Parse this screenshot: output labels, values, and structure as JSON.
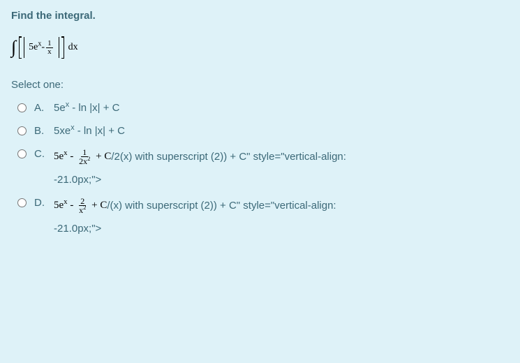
{
  "question": "Find the integral.",
  "integral": {
    "main": "5e",
    "exp": "x",
    "minus": " - ",
    "fnum": "1",
    "fden": "x",
    "dx": "dx"
  },
  "select": "Select one:",
  "options": {
    "a": {
      "label": "A.",
      "pre": "5e",
      "exp": "x",
      "rest": " - ln |x| + C"
    },
    "b": {
      "label": "B.",
      "pre": "5xe",
      "exp": "x",
      "rest": " - ln |x| + C"
    },
    "c": {
      "label": "C.",
      "pre": "5e",
      "exp": "x",
      "minus": " - ",
      "fnum": "1",
      "fden_a": "2x",
      "fden_sup": "2",
      "plusC": " + C",
      "tail": "/2(x) with superscript (2)) + C\" style=\"vertical-align:",
      "line2": "-21.0px;\">"
    },
    "d": {
      "label": "D.",
      "pre": "5e",
      "exp": "x",
      "minus": " - ",
      "fnum": "2",
      "fden_a": "x",
      "fden_sup": "2",
      "plusC": " + C",
      "tail": "/(x) with superscript (2)) + C\" style=\"vertical-align:",
      "line2": "-21.0px;\">"
    }
  }
}
